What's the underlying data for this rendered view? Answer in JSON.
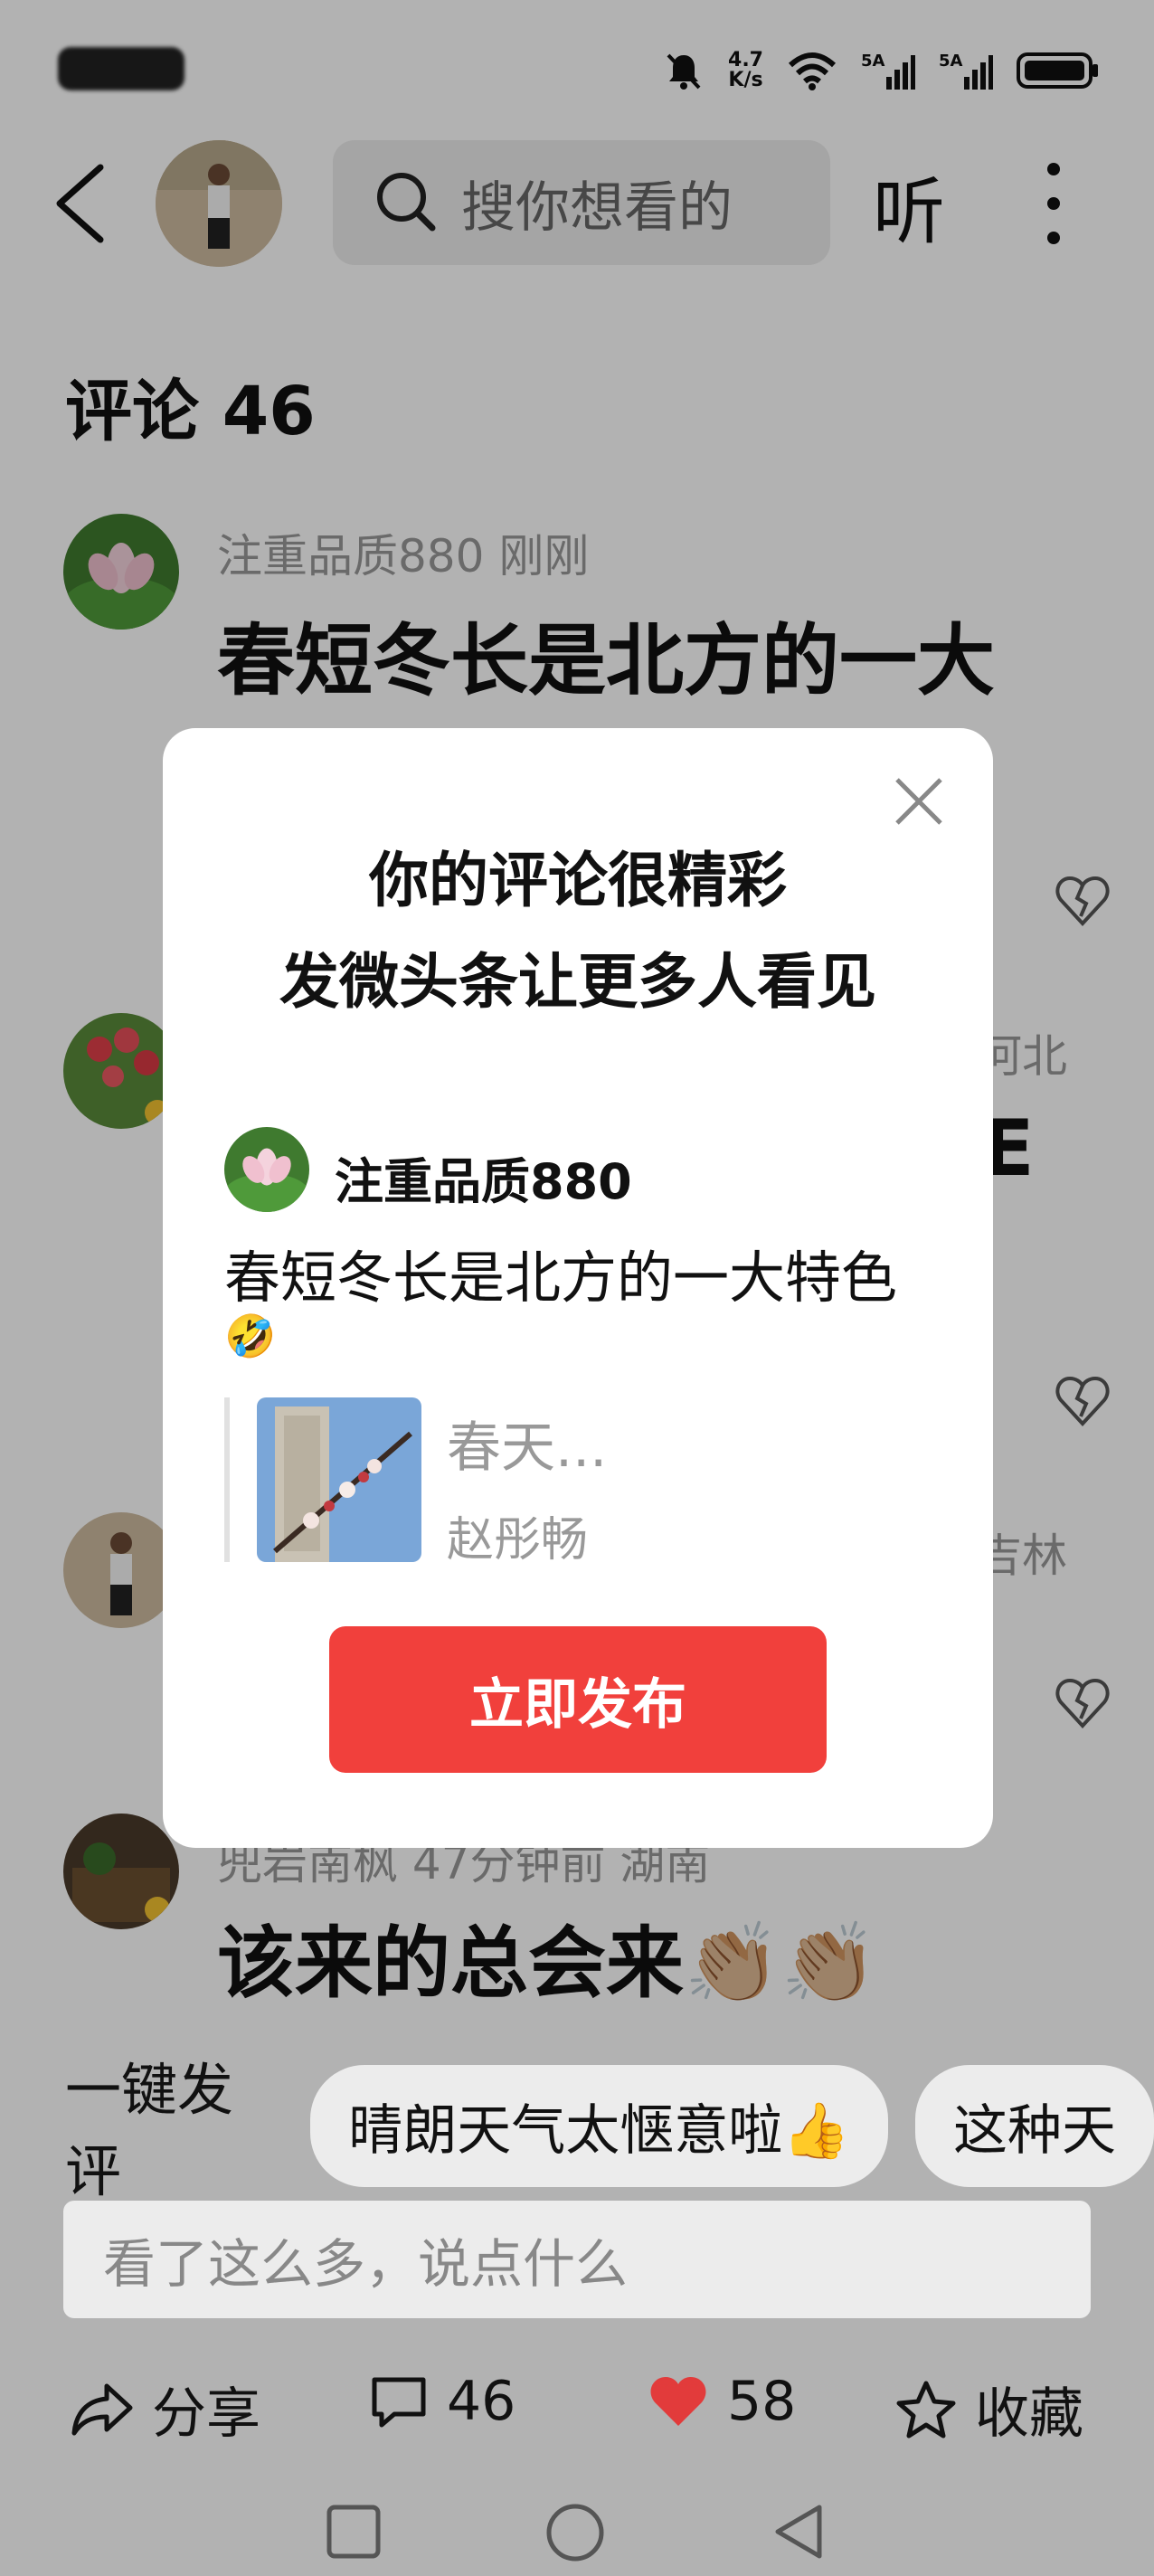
{
  "header": {
    "search_placeholder": "搜你想看的",
    "listen_label": "听"
  },
  "comments": {
    "title": "评论 46",
    "items": [
      {
        "meta": "注重品质880  刚刚",
        "text": "春短冬长是北方的一大"
      },
      {
        "meta": "",
        "text": "",
        "location": "河北",
        "partial": "E"
      },
      {
        "meta": "",
        "text": "",
        "location": "吉林"
      },
      {
        "meta": "兜岩南枫 47分钟前 湖南",
        "text": "该来的总会来👏🏼👏🏼"
      }
    ]
  },
  "modal": {
    "title_line1": "你的评论很精彩",
    "title_line2": "发微头条让更多人看见",
    "username": "注重品质880",
    "comment_text": "春短冬长是北方的一大特色",
    "emoji": "🤣",
    "article_title": "春天...",
    "article_author": "赵彤畅",
    "publish_label": "立即发布"
  },
  "quick_reply": {
    "label": "一键发评",
    "chips": [
      "晴朗天气太惬意啦👍",
      "这种天"
    ]
  },
  "input": {
    "placeholder": "看了这么多，说点什么"
  },
  "actions": {
    "share": "分享",
    "comments": "46",
    "likes": "58",
    "favorite": "收藏"
  },
  "status": {
    "speed_top": "4.7",
    "speed_bottom": "K/s"
  },
  "colors": {
    "publish_button": "#f1403c",
    "like_heart": "#e23b3b"
  }
}
